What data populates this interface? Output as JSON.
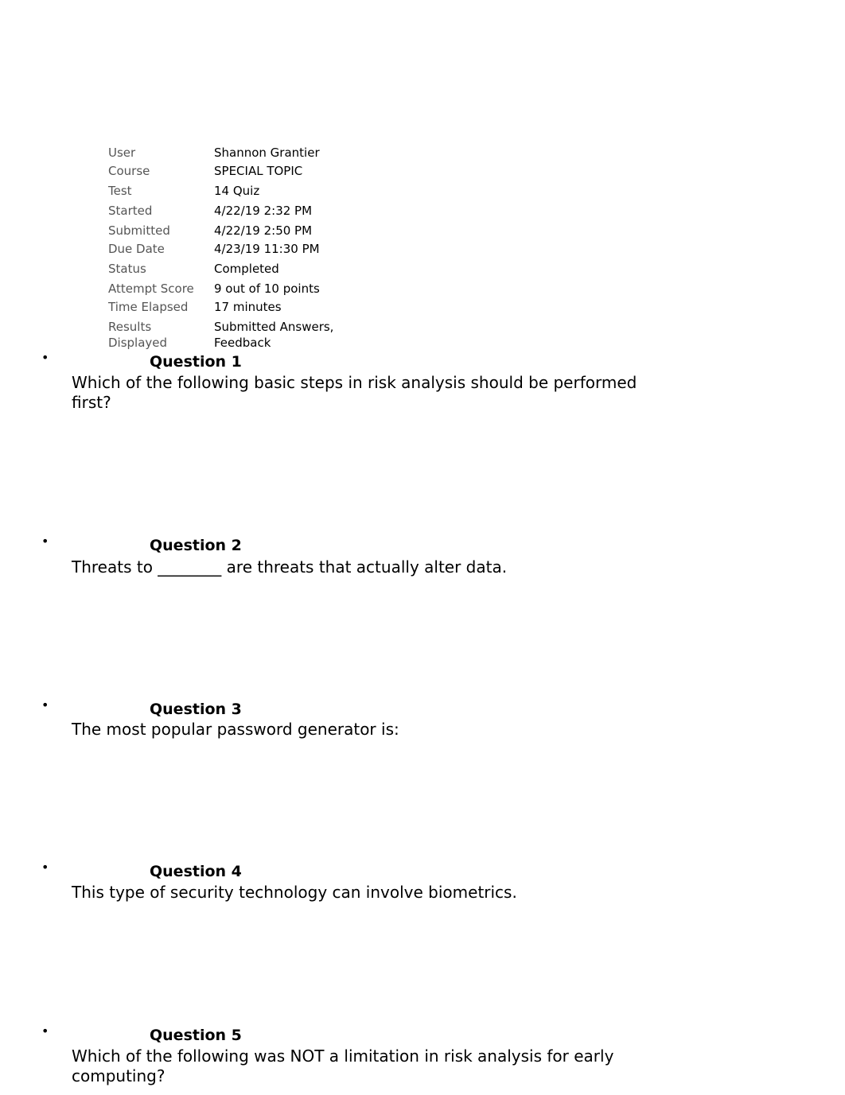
{
  "summary": [
    {
      "label": "User",
      "value": "Shannon Grantier"
    },
    {
      "label": "Course",
      "value": "SPECIAL TOPIC"
    },
    {
      "label": "Test",
      "value": "14 Quiz"
    },
    {
      "label": "Started",
      "value": "4/22/19 2:32 PM"
    },
    {
      "label": "Submitted",
      "value": "4/22/19 2:50 PM"
    },
    {
      "label": "Due Date",
      "value": "4/23/19 11:30 PM"
    },
    {
      "label": "Status",
      "value": "Completed"
    },
    {
      "label": "Attempt Score",
      "value": "9 out of 10 points"
    },
    {
      "label": "Time Elapsed",
      "value": "17 minutes"
    },
    {
      "label": "Results Displayed",
      "value": "Submitted Answers, Feedback"
    }
  ],
  "questions": [
    {
      "title": "Question 1",
      "text": "Which of the following basic steps in risk analysis should be performed first?"
    },
    {
      "title": "Question 2",
      "text": "Threats to ________ are threats that actually alter data."
    },
    {
      "title": "Question 3",
      "text": "The most popular password generator is:"
    },
    {
      "title": "Question 4",
      "text": "This type of security technology can involve biometrics."
    },
    {
      "title": "Question 5",
      "text": "Which of the following was NOT a limitation in risk analysis for early computing?"
    }
  ],
  "bullet_symbol": "•"
}
